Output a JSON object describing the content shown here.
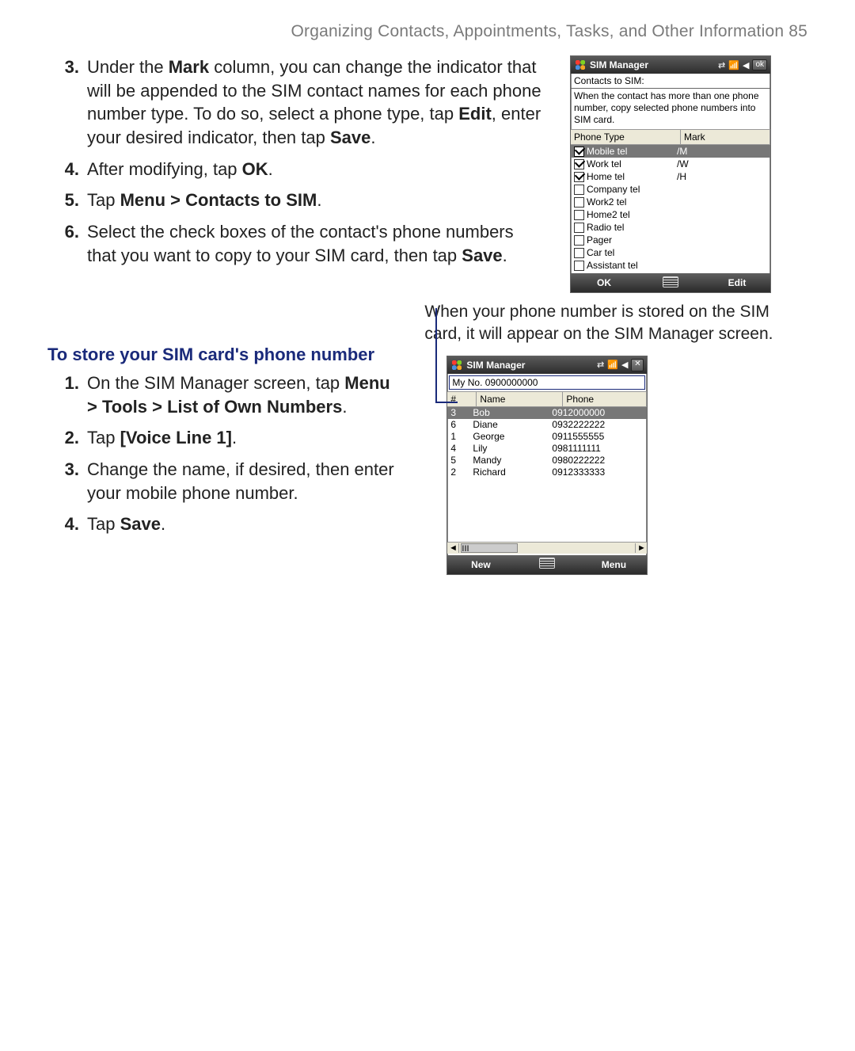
{
  "header": {
    "running_head": "Organizing Contacts, Appointments, Tasks, and Other Information  85"
  },
  "stepsA": {
    "s3_num": "3.",
    "s3_a": "Under the ",
    "s3_b": "Mark",
    "s3_c": " column, you can change the indicator that will be appended to the SIM contact names for each phone number type. To do so, select a phone type, tap ",
    "s3_d": "Edit",
    "s3_e": ", enter your desired indicator, then tap ",
    "s3_f": "Save",
    "s3_g": ".",
    "s4_num": "4.",
    "s4_a": "After modifying, tap ",
    "s4_b": "OK",
    "s4_c": ".",
    "s5_num": "5.",
    "s5_a": "Tap ",
    "s5_b": "Menu > Contacts to SIM",
    "s5_c": ".",
    "s6_num": "6.",
    "s6_a": "Select the check boxes of the contact's phone numbers that you want to copy to your SIM card, then tap ",
    "s6_b": "Save",
    "s6_c": "."
  },
  "subhead": "To store your SIM card's phone number",
  "stepsB": {
    "s1_num": "1.",
    "s1_a": "On the SIM Manager screen, tap ",
    "s1_b": "Menu > Tools > List of Own Numbers",
    "s1_c": ".",
    "s2_num": "2.",
    "s2_a": "Tap ",
    "s2_b": "[Voice Line 1]",
    "s2_c": ".",
    "s3_num": "3.",
    "s3_a": "Change the name, if desired, then enter your mobile phone number.",
    "s4_num": "4.",
    "s4_a": "Tap ",
    "s4_b": "Save",
    "s4_c": "."
  },
  "caption": "When your phone number is stored on the SIM card, it will appear on the SIM Manager screen.",
  "phone1": {
    "title": "SIM Manager",
    "ok": "ok",
    "section": "Contacts to SIM:",
    "note": "When the contact has more than one phone number, copy selected phone numbers into SIM card.",
    "col1": "Phone Type",
    "col2": "Mark",
    "rows": [
      {
        "label": "Mobile tel",
        "mark": "/M",
        "checked": true,
        "sel": true
      },
      {
        "label": "Work tel",
        "mark": "/W",
        "checked": true,
        "sel": false
      },
      {
        "label": "Home tel",
        "mark": "/H",
        "checked": true,
        "sel": false
      },
      {
        "label": "Company tel",
        "mark": "",
        "checked": false,
        "sel": false
      },
      {
        "label": "Work2 tel",
        "mark": "",
        "checked": false,
        "sel": false
      },
      {
        "label": "Home2 tel",
        "mark": "",
        "checked": false,
        "sel": false
      },
      {
        "label": "Radio tel",
        "mark": "",
        "checked": false,
        "sel": false
      },
      {
        "label": "Pager",
        "mark": "",
        "checked": false,
        "sel": false
      },
      {
        "label": "Car tel",
        "mark": "",
        "checked": false,
        "sel": false
      },
      {
        "label": "Assistant tel",
        "mark": "",
        "checked": false,
        "sel": false
      }
    ],
    "cmd_left": "OK",
    "cmd_right": "Edit"
  },
  "phone2": {
    "title": "SIM Manager",
    "myno": "My No. 0900000000",
    "h1": "#",
    "h2": "Name",
    "h3": "Phone",
    "rows": [
      {
        "n": "3",
        "name": "Bob",
        "phone": "0912000000",
        "sel": true
      },
      {
        "n": "6",
        "name": "Diane",
        "phone": "0932222222",
        "sel": false
      },
      {
        "n": "1",
        "name": "George",
        "phone": "0911555555",
        "sel": false
      },
      {
        "n": "4",
        "name": "Lily",
        "phone": "0981111111",
        "sel": false
      },
      {
        "n": "5",
        "name": "Mandy",
        "phone": "0980222222",
        "sel": false
      },
      {
        "n": "2",
        "name": "Richard",
        "phone": "0912333333",
        "sel": false
      }
    ],
    "cmd_left": "New",
    "cmd_right": "Menu",
    "scroll_thumb": "III",
    "arrow_l": "◄",
    "arrow_r": "►"
  }
}
